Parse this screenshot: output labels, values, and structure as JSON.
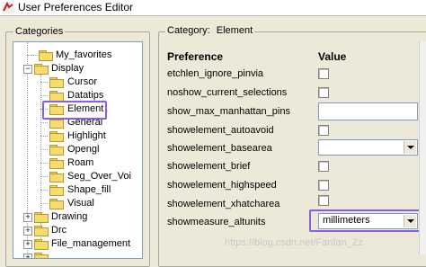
{
  "window": {
    "title": "User Preferences Editor"
  },
  "categories_panel": {
    "label": "Categories",
    "items": [
      {
        "label": "My_favorites"
      },
      {
        "label": "Display"
      },
      {
        "label": "Cursor"
      },
      {
        "label": "Datatips"
      },
      {
        "label": "Element"
      },
      {
        "label": "General"
      },
      {
        "label": "Highlight"
      },
      {
        "label": "Opengl"
      },
      {
        "label": "Roam"
      },
      {
        "label": "Seg_Over_Voi"
      },
      {
        "label": "Shape_fill"
      },
      {
        "label": "Visual"
      },
      {
        "label": "Drawing"
      },
      {
        "label": "Drc"
      },
      {
        "label": "File_management"
      }
    ]
  },
  "main": {
    "category_label": "Category:",
    "category_value": "Element",
    "columns": {
      "preference": "Preference",
      "value": "Value"
    },
    "rows": [
      {
        "name": "etchlen_ignore_pinvia"
      },
      {
        "name": "noshow_current_selections"
      },
      {
        "name": "show_max_manhattan_pins"
      },
      {
        "name": "showelement_autoavoid"
      },
      {
        "name": "showelement_basearea"
      },
      {
        "name": "showelement_brief"
      },
      {
        "name": "showelement_highspeed"
      },
      {
        "name": "showelement_xhatcharea"
      },
      {
        "name": "showmeasure_altunits",
        "value": "millimeters"
      }
    ]
  },
  "watermark": "https://blog.csdn.net/Fanfan_Zz",
  "colors": {
    "highlight_box": "#8a5cf0"
  }
}
